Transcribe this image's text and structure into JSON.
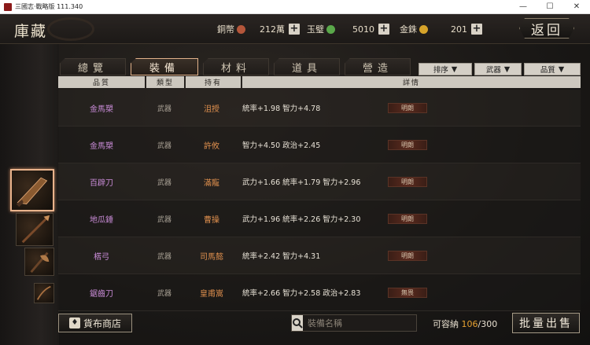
{
  "window": {
    "title": "三國志·戰略版 111.340"
  },
  "header": {
    "title": "庫藏",
    "back_label": "返回",
    "resources": [
      {
        "label": "銅幣",
        "value": "212萬",
        "coin_color": "#b4563a"
      },
      {
        "label": "玉璧",
        "value": "5010",
        "coin_color": "#5aa84a"
      },
      {
        "label": "金銖",
        "value": "201",
        "coin_color": "#d6a32a"
      }
    ]
  },
  "tabs": [
    {
      "label": "總覽",
      "active": false
    },
    {
      "label": "裝備",
      "active": true
    },
    {
      "label": "材料",
      "active": false
    },
    {
      "label": "道具",
      "active": false
    },
    {
      "label": "營造",
      "active": false
    }
  ],
  "filters": [
    "排序",
    "武器",
    "品質"
  ],
  "table": {
    "headers": [
      "品質",
      "類型",
      "持有",
      "詳情"
    ],
    "rows": [
      {
        "quality": "金馬槊",
        "type": "武器",
        "holder": "沮授",
        "details": "統率+1.98  智力+4.78",
        "badge": "明朗"
      },
      {
        "quality": "金馬槊",
        "type": "武器",
        "holder": "許攸",
        "details": "智力+4.50  政治+2.45",
        "badge": "明朗"
      },
      {
        "quality": "百辟刀",
        "type": "武器",
        "holder": "滿寵",
        "details": "武力+1.66  統率+1.79  智力+2.96",
        "badge": "明朗"
      },
      {
        "quality": "地瓜錘",
        "type": "武器",
        "holder": "曹操",
        "details": "武力+1.96  統率+2.26  智力+2.30",
        "badge": "明朗"
      },
      {
        "quality": "楛弓",
        "type": "武器",
        "holder": "司馬懿",
        "details": "統率+2.42  智力+4.31",
        "badge": "明朗"
      },
      {
        "quality": "鋸齒刀",
        "type": "武器",
        "holder": "皇甫嵩",
        "details": "統率+2.66  智力+2.58  政治+2.83",
        "badge": "無畏"
      }
    ]
  },
  "footer": {
    "shop_label": "貨布商店",
    "search_placeholder": "裝備名稱",
    "capacity_label": "可容納",
    "capacity_current": "106",
    "capacity_max": "/300",
    "batch_sell_label": "批量出售"
  }
}
